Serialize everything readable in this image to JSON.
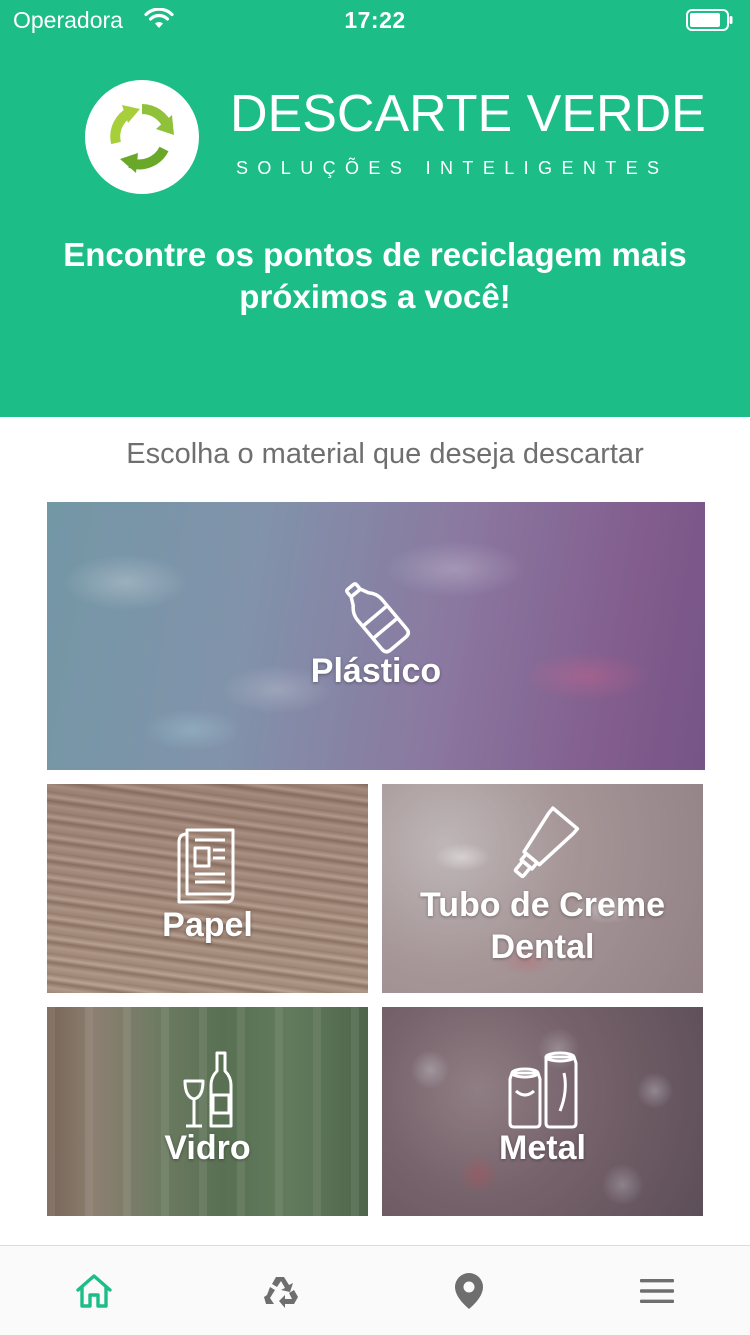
{
  "status_bar": {
    "carrier": "Operadora",
    "time": "17:22"
  },
  "brand": {
    "name": "DESCARTE VERDE",
    "tagline": "SOLUÇÕES INTELIGENTES"
  },
  "header": {
    "headline_line1": "Encontre os pontos de reciclagem mais",
    "headline_line2": "próximos a você!"
  },
  "main": {
    "subtitle": "Escolha o material que deseja descartar",
    "categories": [
      {
        "label": "Plástico",
        "icon": "bottle-icon"
      },
      {
        "label": "Papel",
        "icon": "newspaper-icon"
      },
      {
        "label_line1": "Tubo de Creme",
        "label_line2": "Dental",
        "icon": "toothpaste-tube-icon"
      },
      {
        "label": "Vidro",
        "icon": "glass-bottle-icon"
      },
      {
        "label": "Metal",
        "icon": "cans-icon"
      }
    ]
  },
  "tabbar": {
    "items": [
      {
        "name": "home",
        "icon": "home-icon",
        "active": true
      },
      {
        "name": "recycle",
        "icon": "recycle-icon",
        "active": false
      },
      {
        "name": "map",
        "icon": "map-pin-icon",
        "active": false
      },
      {
        "name": "menu",
        "icon": "menu-icon",
        "active": false
      }
    ]
  },
  "colors": {
    "brand_green": "#1dbd87",
    "tab_active": "#1dbd87",
    "tab_inactive": "#6e6e6e"
  }
}
